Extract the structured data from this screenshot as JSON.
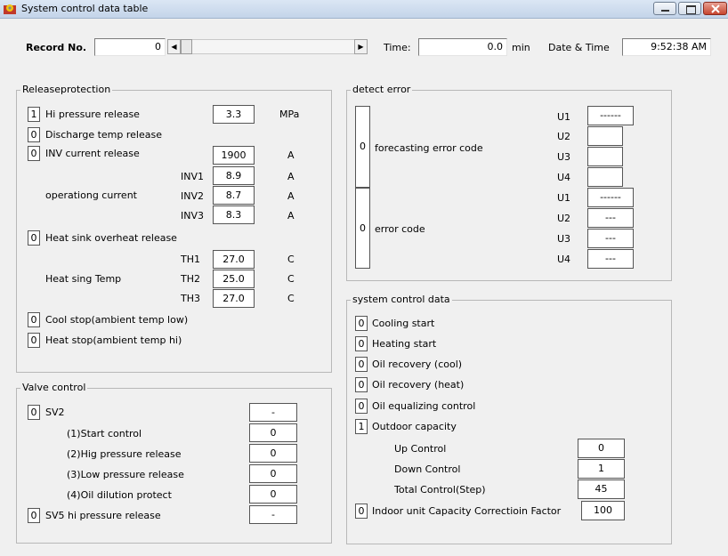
{
  "window": {
    "title": "System control data table",
    "icon": "app-gear-icon",
    "buttons": [
      "minimize",
      "maximize",
      "close"
    ]
  },
  "header": {
    "record_label": "Record No.",
    "record_value": "0",
    "time_label": "Time:",
    "time_value": "0.0",
    "time_unit": "min",
    "datetime_label": "Date & Time",
    "datetime_value": "9:52:38 AM"
  },
  "release": {
    "title": "Releaseprotection",
    "hi_pressure": {
      "flag": "1",
      "label": "Hi pressure release",
      "value": "3.3",
      "unit": "MPa"
    },
    "discharge": {
      "flag": "0",
      "label": "Discharge temp release"
    },
    "inv_current": {
      "flag": "0",
      "label": "INV current release",
      "value": "1900",
      "unit": "A"
    },
    "operating_label": "operationg current",
    "inv": [
      {
        "name": "INV1",
        "value": "8.9",
        "unit": "A"
      },
      {
        "name": "INV2",
        "value": "8.7",
        "unit": "A"
      },
      {
        "name": "INV3",
        "value": "8.3",
        "unit": "A"
      }
    ],
    "heat_sink": {
      "flag": "0",
      "label": "Heat sink overheat release"
    },
    "heat_temp_label": "Heat sing Temp",
    "th": [
      {
        "name": "TH1",
        "value": "27.0",
        "unit": "C"
      },
      {
        "name": "TH2",
        "value": "25.0",
        "unit": "C"
      },
      {
        "name": "TH3",
        "value": "27.0",
        "unit": "C"
      }
    ],
    "cool_stop": {
      "flag": "0",
      "label": "Cool stop(ambient temp low)"
    },
    "heat_stop": {
      "flag": "0",
      "label": "Heat stop(ambient temp hi)"
    }
  },
  "valve": {
    "title": "Valve control",
    "sv2": {
      "flag": "0",
      "label": "SV2",
      "value": "-"
    },
    "items": [
      {
        "label": "(1)Start control",
        "value": "0"
      },
      {
        "label": "(2)Hig pressure release",
        "value": "0"
      },
      {
        "label": "(3)Low pressure release",
        "value": "0"
      },
      {
        "label": "(4)Oil dilution protect",
        "value": "0"
      }
    ],
    "sv5": {
      "flag": "0",
      "label": "SV5 hi pressure release",
      "value": "-"
    }
  },
  "detect": {
    "title": "detect error",
    "forecast": {
      "flag": "0",
      "label": "forecasting error code",
      "units": [
        {
          "name": "U1",
          "value": "------"
        },
        {
          "name": "U2",
          "value": ""
        },
        {
          "name": "U3",
          "value": ""
        },
        {
          "name": "U4",
          "value": ""
        }
      ]
    },
    "error": {
      "flag": "0",
      "label": "error code",
      "units": [
        {
          "name": "U1",
          "value": "------"
        },
        {
          "name": "U2",
          "value": "---"
        },
        {
          "name": "U3",
          "value": "---"
        },
        {
          "name": "U4",
          "value": "---"
        }
      ]
    }
  },
  "syscontrol": {
    "title": "system control data",
    "flags": [
      {
        "flag": "0",
        "label": "Cooling start"
      },
      {
        "flag": "0",
        "label": "Heating start"
      },
      {
        "flag": "0",
        "label": "Oil recovery (cool)"
      },
      {
        "flag": "0",
        "label": "Oil recovery (heat)"
      },
      {
        "flag": "0",
        "label": "Oil equalizing control"
      },
      {
        "flag": "1",
        "label": "Outdoor capacity"
      }
    ],
    "sub": [
      {
        "label": "Up Control",
        "value": "0"
      },
      {
        "label": "Down Control",
        "value": "1"
      },
      {
        "label": "Total Control(Step)",
        "value": "45"
      }
    ],
    "indoor": {
      "flag": "0",
      "label": "Indoor unit Capacity Correctioin Factor",
      "value": "100"
    }
  }
}
